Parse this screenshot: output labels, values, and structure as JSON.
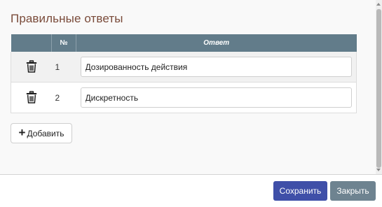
{
  "panel": {
    "title": "Правильные ответы"
  },
  "table": {
    "headers": {
      "delete": "",
      "number": "№",
      "answer": "Ответ"
    },
    "rows": [
      {
        "number": "1",
        "answer": "Дозированность действия"
      },
      {
        "number": "2",
        "answer": "Дискретность"
      }
    ]
  },
  "actions": {
    "add_label": "Добавить",
    "add_icon": "plus-icon",
    "delete_icon": "trash-icon"
  },
  "footer": {
    "save_label": "Сохранить",
    "close_label": "Закрыть"
  },
  "colors": {
    "title": "#7a4b3a",
    "table_header": "#627c8a",
    "save_button": "#3f4fa8",
    "close_button": "#6e8390"
  }
}
